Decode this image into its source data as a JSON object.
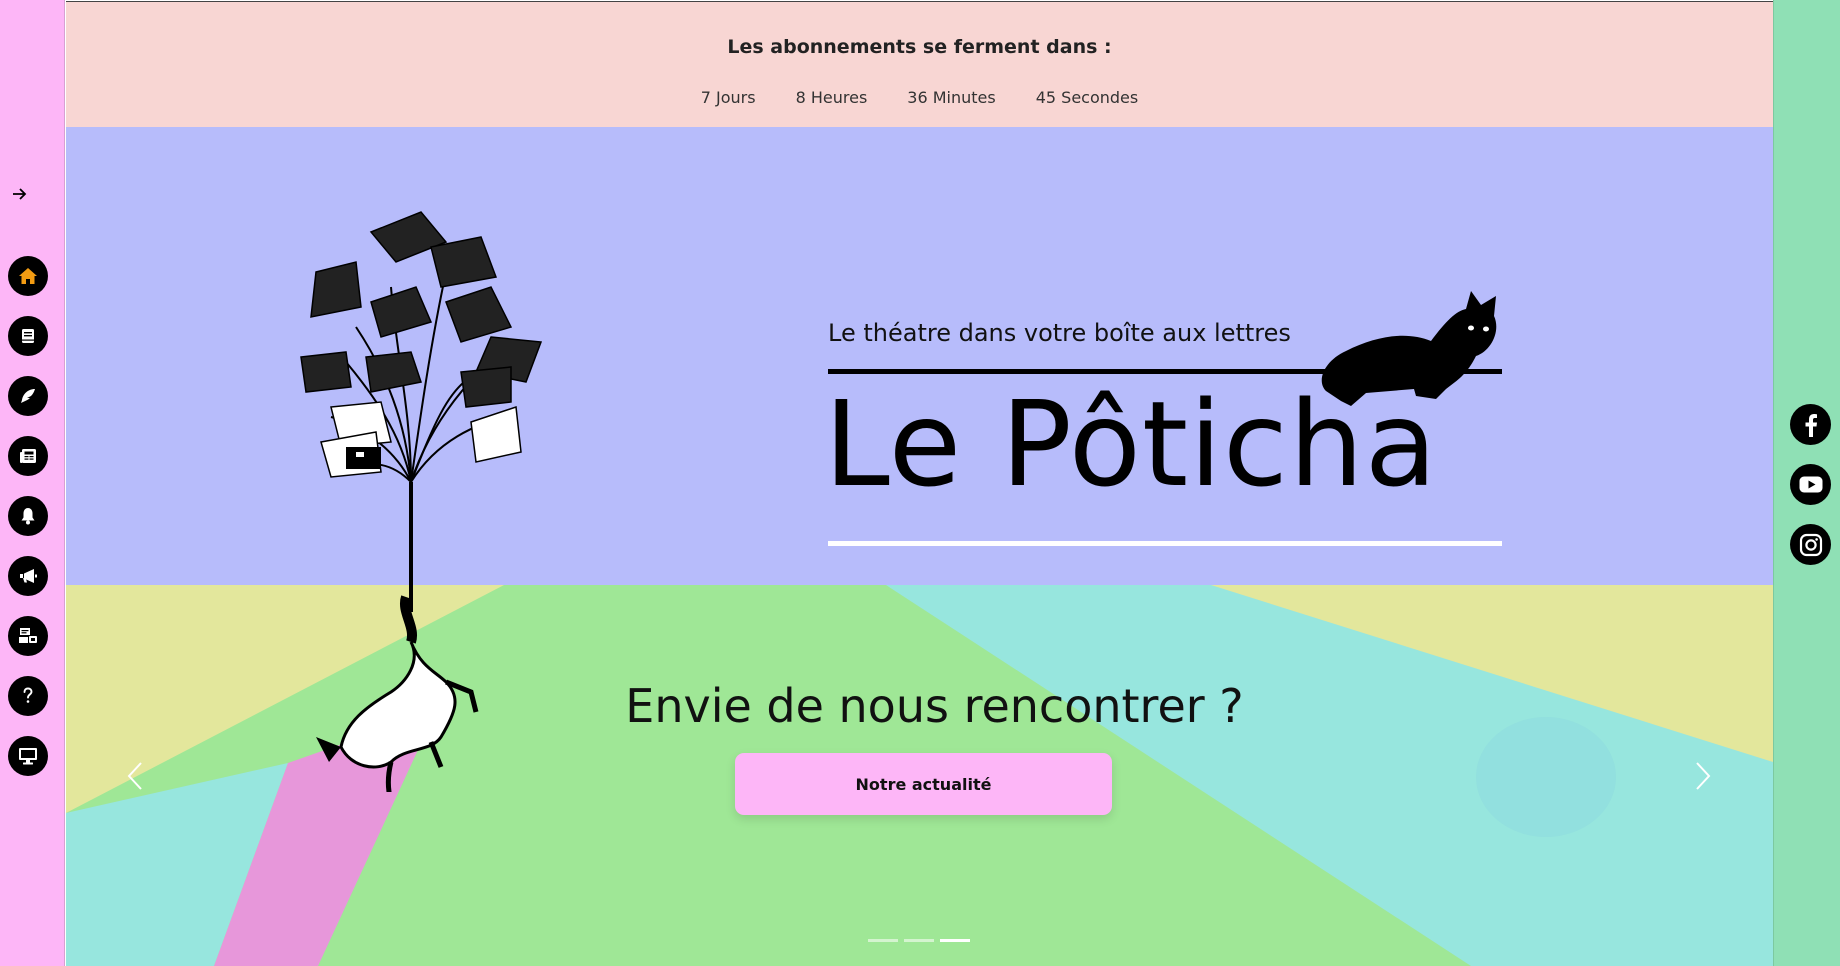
{
  "countdown": {
    "title": "Les abonnements se ferment dans :",
    "units": [
      {
        "label": "7 Jours"
      },
      {
        "label": "8 Heures"
      },
      {
        "label": "36 Minutes"
      },
      {
        "label": "45 Secondes"
      }
    ]
  },
  "sidebar": {
    "expand_icon": "arrow-right-icon",
    "items": [
      {
        "icon": "home-icon",
        "active": true
      },
      {
        "icon": "book-icon"
      },
      {
        "icon": "feather-icon"
      },
      {
        "icon": "newspaper-icon"
      },
      {
        "icon": "bell-icon"
      },
      {
        "icon": "megaphone-icon"
      },
      {
        "icon": "mailbox-icon"
      },
      {
        "icon": "question-icon"
      },
      {
        "icon": "desktop-icon"
      }
    ]
  },
  "social": [
    {
      "icon": "facebook-icon"
    },
    {
      "icon": "youtube-icon"
    },
    {
      "icon": "instagram-icon"
    }
  ],
  "hero": {
    "tagline": "Le théatre dans votre boîte aux lettres",
    "brand": "Le Pôticha",
    "cta_title": "Envie de nous rencontrer ?",
    "cta_button": "Notre actualité",
    "slide_count": 3,
    "active_slide": 3
  },
  "colors": {
    "left_sidebar": "#fdb6f7",
    "right_sidebar": "#8fe0b5",
    "banner": "#f8d6d3",
    "hero_top": "#b7bcfb",
    "accent_active_icon": "#f39c12"
  }
}
